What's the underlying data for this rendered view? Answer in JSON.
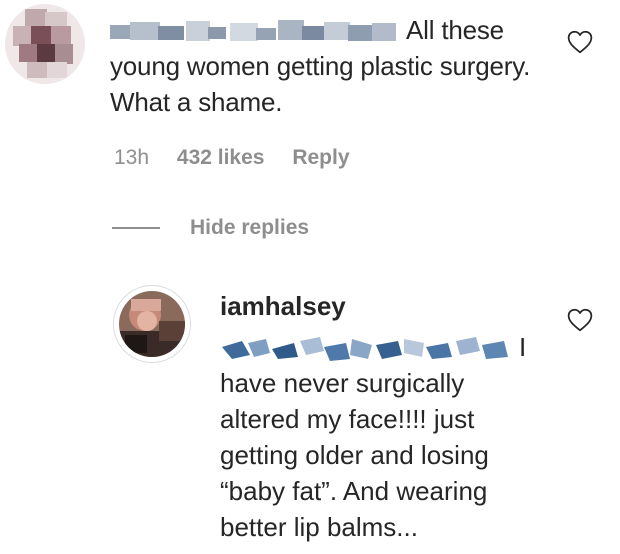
{
  "comment": {
    "text_first_line": "All these",
    "text_rest": "young women getting plastic surgery. What a shame.",
    "time": "13h",
    "likes": "432 likes",
    "reply_label": "Reply"
  },
  "thread": {
    "toggle_label": "Hide replies"
  },
  "reply": {
    "username": "iamhalsey",
    "text_after_mention": "I",
    "text": "have never surgically altered my face!!!! just getting older and losing “baby fat”. And wearing better lip balms..."
  },
  "icons": {
    "like": "heart-outline-icon"
  },
  "colors": {
    "text": "#262626",
    "muted": "#8e8e8e",
    "border": "#dbdbdb"
  }
}
